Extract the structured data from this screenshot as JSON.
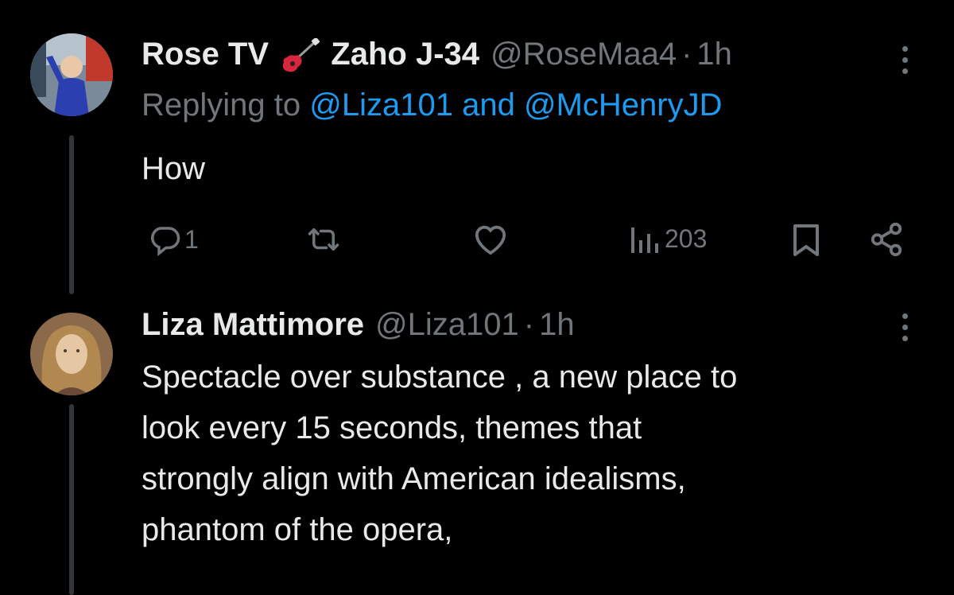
{
  "tweet1": {
    "display_name_part1": "Rose TV",
    "emoji": "guitar-emoji",
    "display_name_part2": "Zaho J-34",
    "handle": "@RoseMaa4",
    "separator": "·",
    "time": "1h",
    "replying_prefix": "Replying to",
    "mention1": "@Liza101",
    "conjunction": "and",
    "mention2": "@McHenryJD",
    "text": "How",
    "reply_count": "1",
    "views": "203"
  },
  "tweet2": {
    "display_name": "Liza Mattimore",
    "handle": "@Liza101",
    "separator": "·",
    "time": "1h",
    "text_lines": [
      "Spectacle over substance , a new place to",
      "look every 15 seconds, themes that",
      "strongly align with American idealisms,",
      "phantom of the opera,"
    ]
  },
  "colors": {
    "background": "#000000",
    "text": "#e7e9ea",
    "muted": "#71767b",
    "accent": "#1d9bf0",
    "thread_line": "#333639"
  }
}
